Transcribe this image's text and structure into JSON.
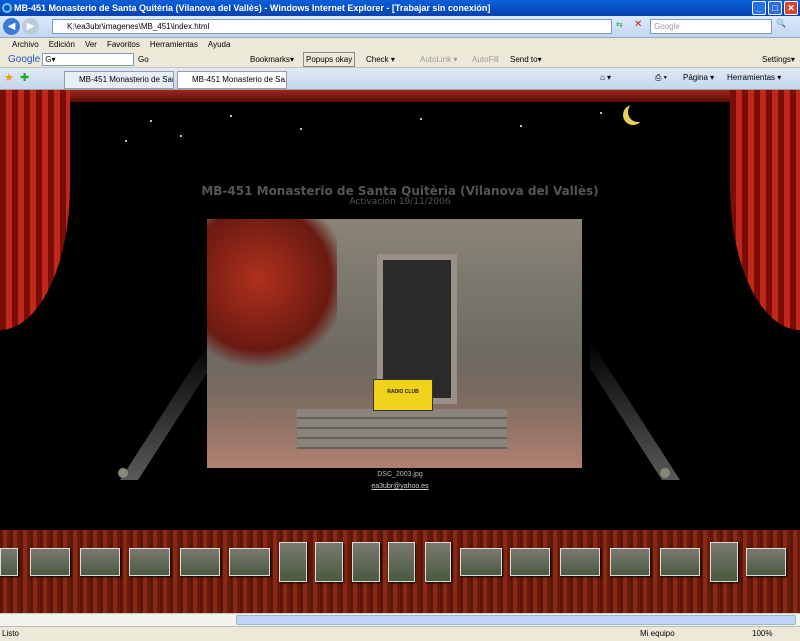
{
  "window": {
    "title": "MB-451 Monasterio de Santa Quitèria (Vilanova del Vallès) - Windows Internet Explorer - [Trabajar sin conexión]"
  },
  "address": {
    "url": "K:\\ea3ubr\\imagenes\\MB_451\\index.html",
    "search_placeholder": "Google"
  },
  "menu": [
    "Archivo",
    "Edición",
    "Ver",
    "Favoritos",
    "Herramientas",
    "Ayuda"
  ],
  "google_bar": {
    "logo": "Google",
    "go": "Go",
    "bookmarks": "Bookmarks▾",
    "popups": "Popups okay",
    "check": "Check ▾",
    "autolink": "AutoLink ▾",
    "autofill": "AutoFill",
    "sendto": "Send to▾",
    "settings": "Settings▾"
  },
  "tabs": [
    {
      "label": "MB-451 Monasterio de Santa..."
    },
    {
      "label": "MB-451 Monasterio de Sa..."
    }
  ],
  "command_bar": {
    "page": "Página ▾",
    "tools": "Herramientas ▾"
  },
  "page": {
    "title": "MB-451 Monasterio de Santa Quitèria (Vilanova del Vallès)",
    "subtitle": "Activación 19/11/2006",
    "photo_caption": "DSC_2003.jpg",
    "email": "ea3ubr@yahoo.es",
    "sign_text": "RADIO CLUB"
  },
  "status": {
    "text": "Listo",
    "zone": "Mi equipo",
    "zoom": "100%"
  }
}
